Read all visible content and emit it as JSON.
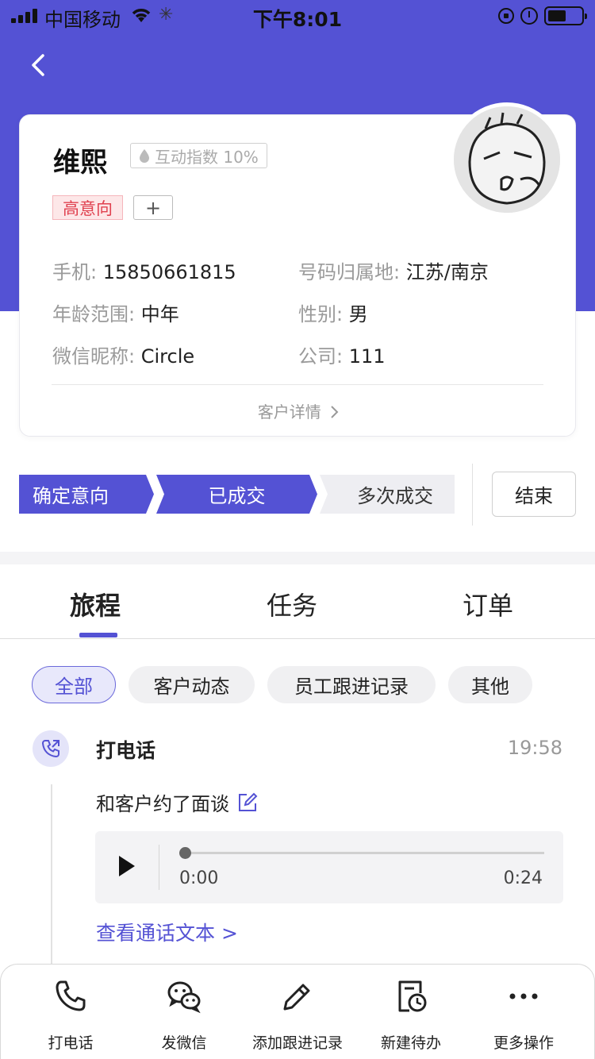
{
  "status_bar": {
    "carrier": "中国移动",
    "time": "下午8:01",
    "battery_level": 0.55
  },
  "customer": {
    "name": "维熙",
    "interaction_badge": "互动指数 10%",
    "tag_label": "高意向",
    "add_tag_label": "+",
    "fields": {
      "phone_label": "手机:",
      "phone_value": "15850661815",
      "location_label": "号码归属地:",
      "location_value": "江苏/南京",
      "age_label": "年龄范围:",
      "age_value": "中年",
      "gender_label": "性别:",
      "gender_value": "男",
      "wechat_label": "微信昵称:",
      "wechat_value": "Circle",
      "company_label": "公司:",
      "company_value": "111"
    },
    "detail_link": "客户详情"
  },
  "stages": {
    "items": [
      "确定意向",
      "已成交",
      "多次成交"
    ],
    "end_button": "结束"
  },
  "tabs": [
    "旅程",
    "任务",
    "订单"
  ],
  "filters": [
    "全部",
    "客户动态",
    "员工跟进记录",
    "其他"
  ],
  "timeline": {
    "entry": {
      "title": "打电话",
      "time": "19:58",
      "note": "和客户约了面谈",
      "audio_current": "0:00",
      "audio_total": "0:24",
      "transcript_link": "查看通话文本 >"
    }
  },
  "bottom_bar": [
    "打电话",
    "发微信",
    "添加跟进记录",
    "新建待办",
    "更多操作"
  ],
  "colors": {
    "primary": "#5452d4",
    "tag_red": "#e0414f"
  }
}
